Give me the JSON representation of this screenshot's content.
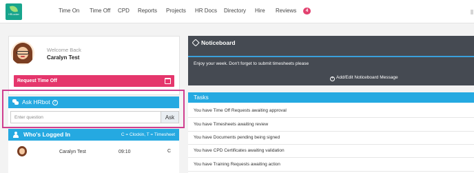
{
  "logo": {
    "text": "HRLocker",
    "subtext": "Happy Working"
  },
  "nav": {
    "items": [
      {
        "label": "Time On"
      },
      {
        "label": "Time Off"
      },
      {
        "label": "CPD"
      },
      {
        "label": "Reports"
      },
      {
        "label": "Projects"
      },
      {
        "label": "HR Docs"
      },
      {
        "label": "Directory"
      },
      {
        "label": "Hire"
      },
      {
        "label": "Reviews"
      }
    ],
    "badge": "4"
  },
  "profile": {
    "welcome": "Welcome Back",
    "name": "Caralyn Test",
    "request_time_off": "Request Time Off"
  },
  "hrbot": {
    "title": "Ask HRbot",
    "help": "?",
    "placeholder": "Enter question",
    "ask_label": "Ask"
  },
  "whos_logged_in": {
    "title": "Who's Logged In",
    "legend": "C = Clockin, T = Timesheet",
    "rows": [
      {
        "name": "Caralyn Test",
        "time": "09:10",
        "type": "C"
      }
    ]
  },
  "noticeboard": {
    "title": "Noticeboard",
    "message": "Enjoy your week. Don't forget to submit timesheets please",
    "add_edit_label": "Add/Edit Noticeboard Message"
  },
  "tasks": {
    "title": "Tasks",
    "items": [
      "You have Time Off Requests awaiting approval",
      "You have Timesheets awaiting review",
      "You have Documents pending being signed",
      "You have CPD Certificates awaiting validation",
      "You have Training Requests awaiting action"
    ]
  },
  "colors": {
    "accent_blue": "#25a9e1",
    "pink": "#e5366c",
    "dark_panel": "#454a52",
    "highlight": "#cf3e8f"
  }
}
